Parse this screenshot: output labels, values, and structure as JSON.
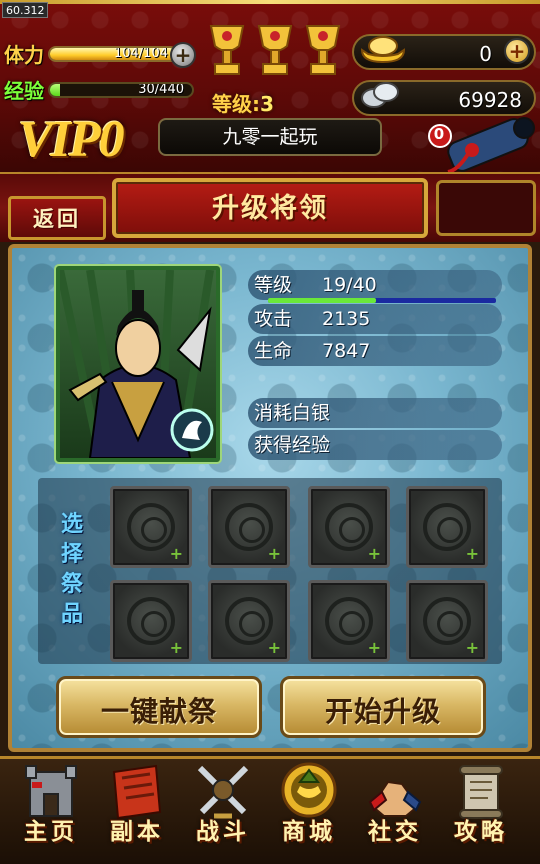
{
  "fps": "60.312",
  "hud": {
    "stamina_label": "体力",
    "stamina_value": "104/104",
    "stamina_fill": 1.0,
    "exp_label": "经验",
    "exp_value": "30/440",
    "exp_fill": 0.068,
    "level_label": "等级:",
    "level_value": "3",
    "gold_ingot": "0",
    "silver": "69928",
    "vip": "VIP0",
    "server_name": "九零一起玩",
    "cannon_badge": "0"
  },
  "title": {
    "back_label": "返回",
    "page_title": "升级将领"
  },
  "general": {
    "level_label": "等级",
    "level_value": "19/40",
    "level_fill": 0.475,
    "attack_label": "攻击",
    "attack_value": "2135",
    "hp_label": "生命",
    "hp_value": "7847",
    "cost_label": "消耗白银",
    "gain_label": "获得经验"
  },
  "offerings": {
    "select_label_1": "选",
    "select_label_2": "择",
    "select_label_3": "祭",
    "select_label_4": "品",
    "slot_plus": "+"
  },
  "actions": {
    "one_click": "一键献祭",
    "start_upgrade": "开始升级"
  },
  "nav": {
    "home": "主页",
    "dungeon": "副本",
    "battle": "战斗",
    "shop": "商城",
    "social": "社交",
    "guide": "攻略"
  },
  "colors": {
    "accent_gold": "#d7a73b",
    "title_red": "#b51c14",
    "panel_blue": "#79b6cf",
    "exp_green": "#7dff3a"
  }
}
